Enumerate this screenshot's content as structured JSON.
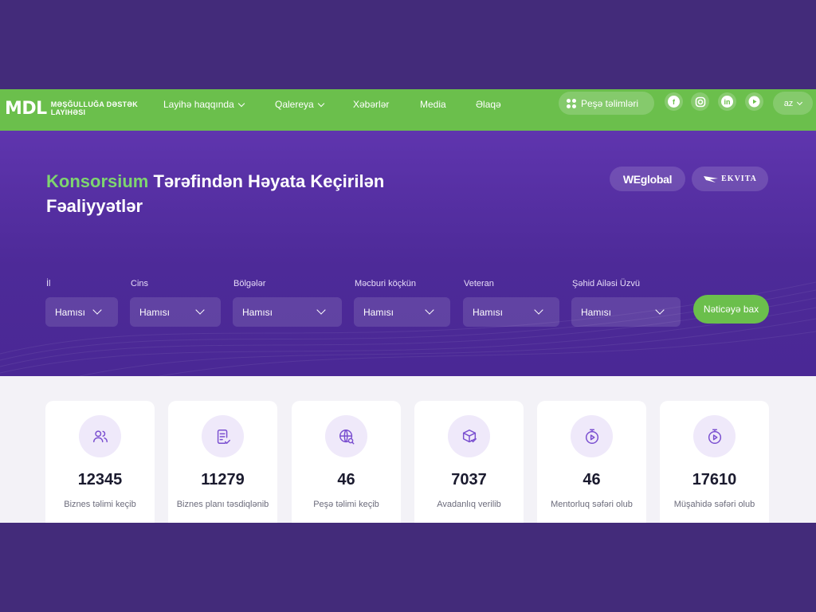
{
  "header": {
    "logo_mark": "MDL",
    "logo_line1": "Məşğulluğa Dəstək",
    "logo_line2": "Layihəsi",
    "nav": [
      "Layihə haqqında",
      "Qalereya",
      "Xəbərlər",
      "Media",
      "Əlaqə"
    ],
    "cta_label": "Peşə təlimləri",
    "socials": [
      "facebook-icon",
      "instagram-icon",
      "linkedin-icon",
      "youtube-icon"
    ],
    "facebook": "f",
    "linkedin": "in",
    "language": "az"
  },
  "hero": {
    "title_accent": "Konsorsium",
    "title_rest": "Tərəfindən Həyata Keçirilən Fəaliyyətlər",
    "partner1": "WEglobal",
    "partner2": "EKVITA"
  },
  "filters": [
    {
      "label": "İl",
      "value": "Hamısı"
    },
    {
      "label": "Cins",
      "value": "Hamısı"
    },
    {
      "label": "Bölgələr",
      "value": "Hamısı"
    },
    {
      "label": "Məcburi köçkün",
      "value": "Hamısı"
    },
    {
      "label": "Veteran",
      "value": "Hamısı"
    },
    {
      "label": "Şəhid Ailəsi Üzvü",
      "value": "Hamısı"
    }
  ],
  "search_label": "Nəticəyə bax",
  "stats": [
    {
      "value": "12345",
      "label": "Biznes təlimi keçib",
      "icon": "users-icon"
    },
    {
      "value": "11279",
      "label": "Biznes planı təsdiqlənib",
      "icon": "document-check-icon"
    },
    {
      "value": "46",
      "label": "Peşə təlimi keçib",
      "icon": "globe-search-icon"
    },
    {
      "value": "7037",
      "label": "Avadanlıq verilib",
      "icon": "box-check-icon"
    },
    {
      "value": "46",
      "label": "Mentorluq səfəri olub",
      "icon": "stopwatch-play-icon"
    },
    {
      "value": "17610",
      "label": "Müşahidə səfəri olub",
      "icon": "stopwatch-play-icon"
    }
  ],
  "colors": {
    "green": "#6bbf4c",
    "purple": "#5f35ae",
    "accent_text": "#7ed56f"
  }
}
